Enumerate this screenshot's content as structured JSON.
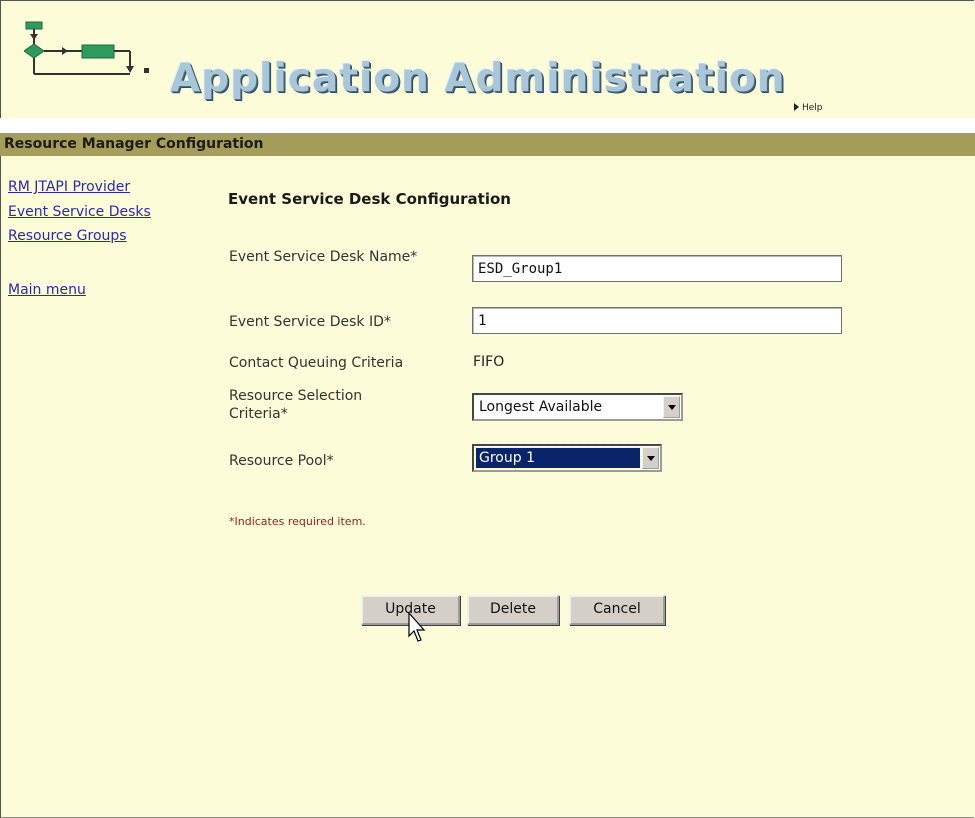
{
  "header": {
    "title": "Application Administration",
    "help_label": "Help"
  },
  "section": {
    "title": "Resource Manager Configuration"
  },
  "nav": {
    "items": [
      {
        "label": "RM JTAPI Provider"
      },
      {
        "label": "Event Service Desks"
      },
      {
        "label": "Resource Groups"
      },
      {
        "label": "Main menu"
      }
    ]
  },
  "form": {
    "title": "Event Service Desk Configuration",
    "fields": {
      "name": {
        "label": "Event Service Desk Name*",
        "value": "ESD_Group1"
      },
      "id": {
        "label": "Event Service Desk ID*",
        "value": "1"
      },
      "queuing": {
        "label": "Contact Queuing Criteria",
        "value": "FIFO"
      },
      "selection": {
        "label": "Resource Selection Criteria*",
        "value": "Longest Available"
      },
      "pool": {
        "label": "Resource Pool*",
        "value": "Group 1"
      }
    },
    "required_note": "*Indicates required item."
  },
  "buttons": {
    "update": "Update",
    "delete": "Delete",
    "cancel": "Cancel"
  },
  "colors": {
    "background": "#fdfcd9",
    "section_bar": "#a59e5a",
    "link": "#2a2aa8",
    "logo_green": "#2e9a5e",
    "selected_highlight": "#0a246a"
  }
}
